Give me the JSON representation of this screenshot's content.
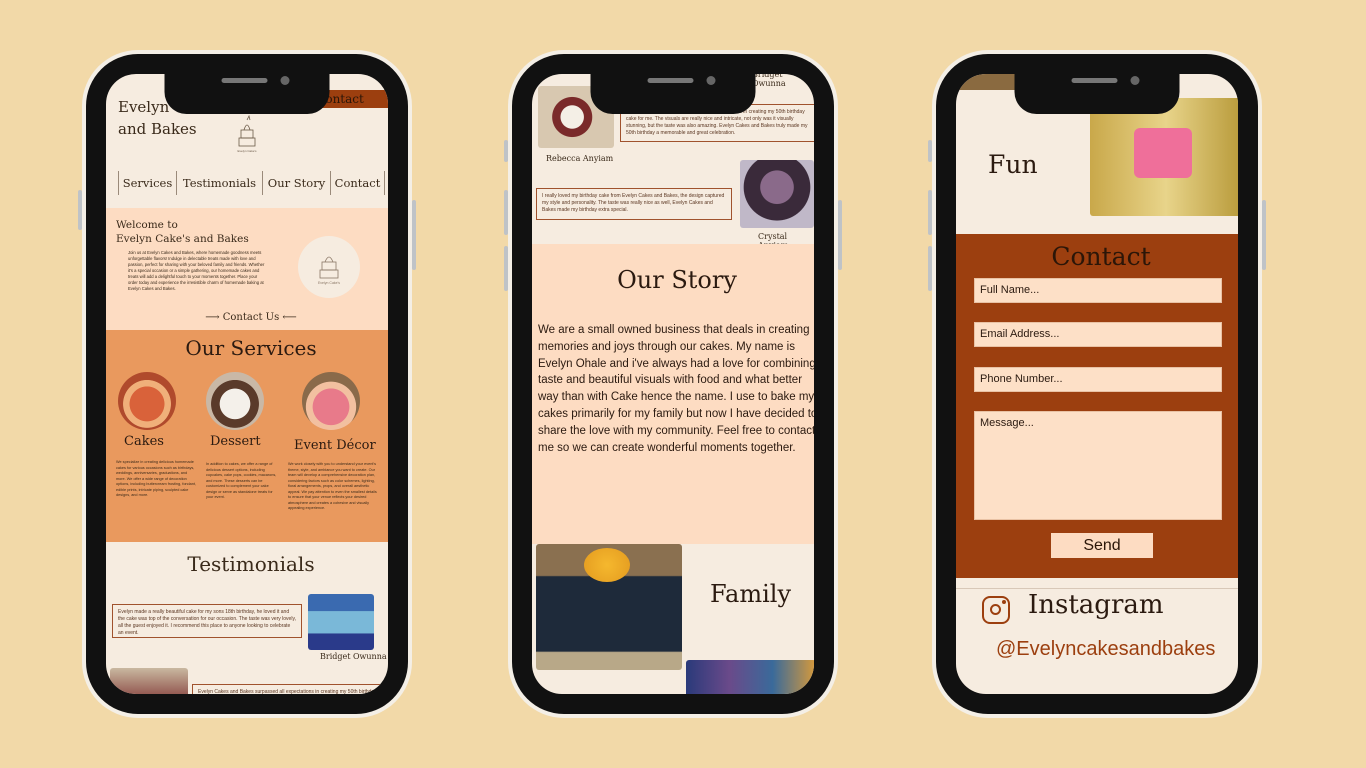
{
  "phone1": {
    "brand": "Evelyn Cake's\nand Bakes",
    "contact_button": "Contact",
    "nav": [
      "Services",
      "Testimonials",
      "Our Story",
      "Contact"
    ],
    "welcome_title": "Welcome to\nEvelyn Cake's and Bakes",
    "welcome_text": "Join us at Evelyn Cakes and Bakes, where homemade goodness meets unforgettable flavors! Indulge in delectable treats made with love and passion, perfect for sharing with your beloved family and friends. Whether it's a special occasion or a simple gathering, our homemade cakes and treats will add a delightful touch to your moments together. Place your order today and experience the irresistible charm of homemade baking at Evelyn Cakes and Bakes.",
    "contact_us_link": "⟶ Contact Us ⟵",
    "services_title": "Our Services",
    "services": [
      {
        "title": "Cakes",
        "text": "We specialize in creating delicious homemade cakes for various occasions such as birthdays, weddings, anniversaries, graduations, and more. We offer a wide range of decoration options, including buttercream frosting, fondant, edible prints, intricate piping, sculpted cake designs, and more."
      },
      {
        "title": "Dessert",
        "text": "In addition to cakes, we offer a range of delicious dessert options, including cupcakes, cake pops, cookies, macarons, and more. These desserts can be customized to complement your cake design or serve as standalone treats for your event."
      },
      {
        "title": "Event Décor",
        "text": "We work closely with you to understand your event's theme, style, and ambiance you want to create. Our team will develop a comprehensive decoration plan, considering factors such as color schemes, lighting, floral arrangements, props, and overall aesthetic appeal. We pay attention to even the smallest details to ensure that your venue reflects your desired atmosphere and creates a cohesive and visually appealing experience."
      }
    ],
    "testimonials_title": "Testimonials",
    "testimonial1": "Evelyn made a really beautiful cake for my sons 18th birthday, he loved it and the cake was top of the conversation for our occasion. The taste was very lovely, all the guest enjoyed it. I recommend this place to anyone looking to celebrate an event.",
    "testimonial1_name": "Bridget Owunna",
    "testimonial2": "Evelyn Cakes and Bakes surpassed all expectations in creating my 50th birthday cake for me. The visuals are really nice and intricate, not only was it visually"
  },
  "phone2": {
    "top_name": "Bridget Owunna",
    "testimonial2": "Evelyn Cakes and Bakes surpassed all expectations in creating my 50th birthday cake for me. The visuals are really nice and intricate, not only was it visually stunning, but the taste was also amazing. Evelyn Cakes and Bakes truly made my 50th birthday a memorable and great celebration.",
    "testimonial2_name": "Rebecca Anyiam",
    "testimonial3": "I really loved my birthday cake from Evelyn Cakes and Bakes, the design captured my style and personality. The taste was really nice as well, Evelyn Cakes and Bakes made my birthday extra special.",
    "testimonial3_name": "Crystal Anyiam",
    "story_title": "Our Story",
    "story_text": "We are a small owned business that deals in creating memories and joys through our cakes. My name is Evelyn Ohale and i've always had a love for combining taste and beautiful visuals with food and what better way than with Cake hence the name. I use to bake my cakes primarily for my family but now I have decided to share the love with my community. Feel free to contact me so we can create wonderful moments together.",
    "family_label": "Family"
  },
  "phone3": {
    "fun_label": "Fun",
    "contact_title": "Contact",
    "full_name_placeholder": "Full Name...",
    "email_placeholder": "Email Address...",
    "phone_placeholder": "Phone Number...",
    "message_placeholder": "Message...",
    "send_label": "Send",
    "instagram_label": "Instagram",
    "instagram_handle": "@Evelyncakesandbakes"
  },
  "colors": {
    "background": "#f2d9a8",
    "cream": "#f6ece0",
    "peach": "#fddcc2",
    "orange": "#e9995e",
    "rust": "#9c3f0f"
  }
}
